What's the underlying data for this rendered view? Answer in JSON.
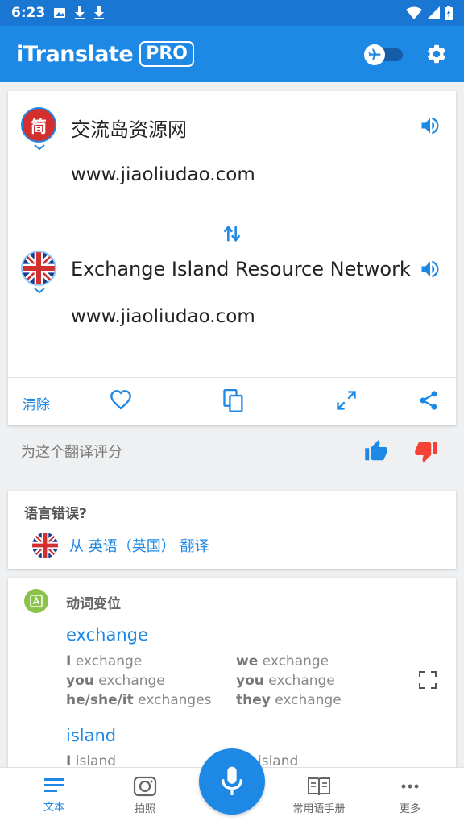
{
  "status": {
    "time": "6:23"
  },
  "app": {
    "brand": "iTranslate",
    "pro": "PRO"
  },
  "source": {
    "text": "交流岛资源网",
    "subtext": "www.jiaoliudao.com",
    "flag_label": "简"
  },
  "target": {
    "text": "Exchange Island Resource Network",
    "subtext": "www.jiaoliudao.com"
  },
  "actions": {
    "clear": "清除"
  },
  "rating": {
    "prompt": "为这个翻译评分"
  },
  "language_error": {
    "title": "语言错误?",
    "from": "从 英语（英国） 翻译"
  },
  "conjugation": {
    "title": "动词变位",
    "verbs": [
      {
        "word": "exchange",
        "left": [
          [
            "I",
            "exchange"
          ],
          [
            "you",
            "exchange"
          ],
          [
            "he/she/it",
            "exchanges"
          ]
        ],
        "right": [
          [
            "we",
            "exchange"
          ],
          [
            "you",
            "exchange"
          ],
          [
            "they",
            "exchange"
          ]
        ]
      },
      {
        "word": "island",
        "left": [
          [
            "I",
            "island"
          ]
        ],
        "right": [
          [
            "",
            "island"
          ]
        ]
      }
    ]
  },
  "nav": {
    "items": [
      {
        "label": "文本"
      },
      {
        "label": "拍照"
      },
      {
        "label": "常用语手册"
      },
      {
        "label": "更多"
      }
    ]
  },
  "colors": {
    "accent": "#1e88e5",
    "statusbar": "#1976d2",
    "thumb_down": "#f44336",
    "conj_icon": "#8bc34a"
  }
}
